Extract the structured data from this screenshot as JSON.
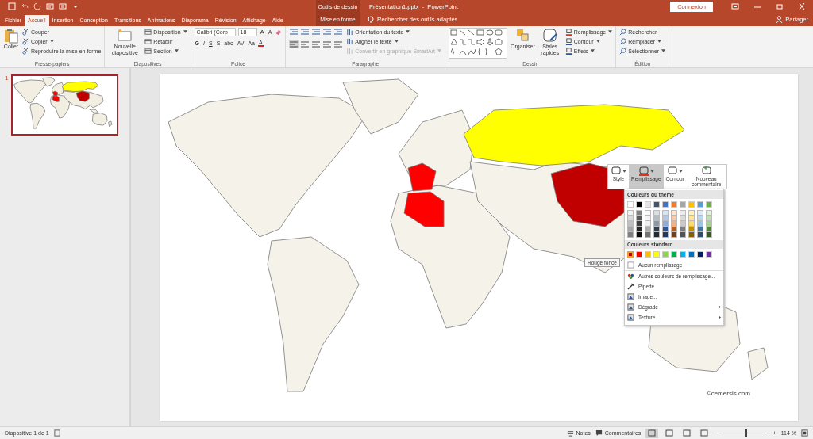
{
  "title_bar": {
    "context_header": "Outils de dessin",
    "title": "Présentation1.pptx  -  PowerPoint",
    "sign_in": "Connexion"
  },
  "tabs": [
    {
      "label": "Fichier",
      "selected": false
    },
    {
      "label": "Accueil",
      "selected": true
    },
    {
      "label": "Insertion",
      "selected": false
    },
    {
      "label": "Conception",
      "selected": false
    },
    {
      "label": "Transitions",
      "selected": false
    },
    {
      "label": "Animations",
      "selected": false
    },
    {
      "label": "Diaporama",
      "selected": false
    },
    {
      "label": "Révision",
      "selected": false
    },
    {
      "label": "Affichage",
      "selected": false
    },
    {
      "label": "Aide",
      "selected": false
    }
  ],
  "contextual_tab": {
    "label": "Mise en forme",
    "selected": false
  },
  "tell_me": "Rechercher des outils adaptés",
  "share": "Partager",
  "ribbon": {
    "clipboard": {
      "title": "Presse-papiers",
      "paste": "Coller",
      "items": [
        {
          "label": "Couper",
          "dropdown": false
        },
        {
          "label": "Copier",
          "dropdown": true
        },
        {
          "label": "Reproduire la mise en forme",
          "dropdown": false
        }
      ]
    },
    "slides": {
      "title": "Diapositives",
      "new_slide": "Nouvelle diapositive",
      "items": [
        {
          "label": "Disposition",
          "dropdown": true
        },
        {
          "label": "Rétablir",
          "dropdown": false
        },
        {
          "label": "Section",
          "dropdown": true
        }
      ]
    },
    "font": {
      "title": "Police",
      "font_name": "Calibri (Corp",
      "font_size": "18",
      "size_buttons": [
        "A",
        "A"
      ],
      "format_buttons": [
        "G",
        "I",
        "S",
        "S",
        "abc",
        "AV",
        "Aa"
      ],
      "color_button": "A"
    },
    "paragraph": {
      "title": "Paragraphe",
      "items": [
        {
          "label": "Orientation du texte",
          "dropdown": true,
          "disabled": false
        },
        {
          "label": "Aligner le texte",
          "dropdown": true,
          "disabled": false
        },
        {
          "label": "Convertir en graphique SmartArt",
          "dropdown": true,
          "disabled": true
        }
      ]
    },
    "drawing": {
      "title": "Dessin",
      "arrange": "Organiser",
      "quick_styles": "Styles rapides",
      "items": [
        {
          "label": "Remplissage",
          "dropdown": true
        },
        {
          "label": "Contour",
          "dropdown": true
        },
        {
          "label": "Effets",
          "dropdown": true
        }
      ]
    },
    "editing": {
      "title": "Édition",
      "items": [
        {
          "label": "Rechercher",
          "dropdown": false
        },
        {
          "label": "Remplacer",
          "dropdown": true
        },
        {
          "label": "Sélectionner",
          "dropdown": true
        }
      ]
    }
  },
  "thumbnails": [
    {
      "number": "1",
      "selected": true
    }
  ],
  "slide": {
    "credit": "©cemersis.com"
  },
  "mini_toolbar": [
    {
      "label": "Style",
      "selected": false,
      "dropdown": true
    },
    {
      "label": "Remplissage",
      "selected": true,
      "dropdown": true
    },
    {
      "label": "Contour",
      "selected": false,
      "dropdown": true
    },
    {
      "label": "Nouveau commentaire",
      "selected": false,
      "dropdown": false
    }
  ],
  "fill_menu": {
    "theme_header": "Couleurs du thème",
    "theme_colors": [
      {
        "color": "#ffffff"
      },
      {
        "color": "#000000"
      },
      {
        "color": "#e7e6e6"
      },
      {
        "color": "#44546a"
      },
      {
        "color": "#4472c4"
      },
      {
        "color": "#ed7d31"
      },
      {
        "color": "#a5a5a5"
      },
      {
        "color": "#ffc000"
      },
      {
        "color": "#5b9bd5"
      },
      {
        "color": "#70ad47"
      }
    ],
    "standard_header": "Couleurs standard",
    "standard_colors": [
      {
        "color": "#c00000",
        "selected": true
      },
      {
        "color": "#ff0000",
        "selected": false
      },
      {
        "color": "#ffc000",
        "selected": false
      },
      {
        "color": "#ffff00",
        "selected": false
      },
      {
        "color": "#92d050",
        "selected": false
      },
      {
        "color": "#00b050",
        "selected": false
      },
      {
        "color": "#00b0f0",
        "selected": false
      },
      {
        "color": "#0070c0",
        "selected": false
      },
      {
        "color": "#002060",
        "selected": false
      },
      {
        "color": "#7030a0",
        "selected": false
      }
    ],
    "tooltip": "Rouge foncé",
    "items": [
      {
        "label": "Aucun remplissage",
        "submenu": false
      },
      {
        "label": "Autres couleurs de remplissage...",
        "submenu": false
      },
      {
        "label": "Pipette",
        "submenu": false
      },
      {
        "label": "Image...",
        "submenu": false
      },
      {
        "label": "Dégradé",
        "submenu": true
      },
      {
        "label": "Texture",
        "submenu": true
      }
    ]
  },
  "status_bar": {
    "slide_info": "Diapositive 1 de 1",
    "notes": "Notes",
    "comments": "Commentaires",
    "views": [
      {
        "selected": true
      },
      {
        "selected": false
      },
      {
        "selected": false
      },
      {
        "selected": false
      }
    ],
    "zoom_out": "−",
    "zoom_in": "+",
    "zoom_slider": {
      "level": 0.5
    },
    "zoom": "114 %"
  }
}
